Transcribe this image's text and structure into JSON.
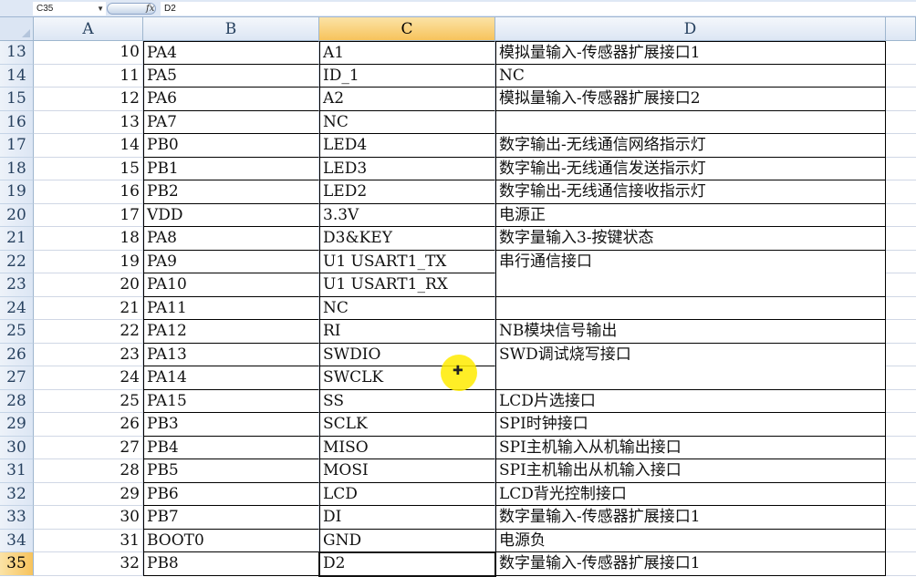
{
  "formula_bar": {
    "name_box": "C35",
    "fx_label": "fx",
    "formula_value": "D2"
  },
  "columns": [
    "A",
    "B",
    "C",
    "D"
  ],
  "active_cell": {
    "row": "35",
    "column": "C"
  },
  "rows": [
    {
      "row": "13",
      "a": "10",
      "b": "PA4",
      "c": "A1",
      "d": "模拟量输入-传感器扩展接口1"
    },
    {
      "row": "14",
      "a": "11",
      "b": "PA5",
      "c": "ID_1",
      "d": "NC"
    },
    {
      "row": "15",
      "a": "12",
      "b": "PA6",
      "c": "A2",
      "d": "模拟量输入-传感器扩展接口2"
    },
    {
      "row": "16",
      "a": "13",
      "b": "PA7",
      "c": "NC",
      "d": ""
    },
    {
      "row": "17",
      "a": "14",
      "b": "PB0",
      "c": "LED4",
      "d": "数字输出-无线通信网络指示灯"
    },
    {
      "row": "18",
      "a": "15",
      "b": "PB1",
      "c": "LED3",
      "d": "数字输出-无线通信发送指示灯"
    },
    {
      "row": "19",
      "a": "16",
      "b": "PB2",
      "c": "LED2",
      "d": "数字输出-无线通信接收指示灯"
    },
    {
      "row": "20",
      "a": "17",
      "b": "VDD",
      "c": "3.3V",
      "d": "电源正"
    },
    {
      "row": "21",
      "a": "18",
      "b": "PA8",
      "c": "D3&KEY",
      "d": "数字量输入3-按键状态"
    },
    {
      "row": "22",
      "a": "19",
      "b": "PA9",
      "c": "U1 USART1_TX",
      "d": "串行通信接口"
    },
    {
      "row": "23",
      "a": "20",
      "b": "PA10",
      "c": "U1 USART1_RX",
      "d": ""
    },
    {
      "row": "24",
      "a": "21",
      "b": "PA11",
      "c": "NC",
      "d": ""
    },
    {
      "row": "25",
      "a": "22",
      "b": "PA12",
      "c": "RI",
      "d": "NB模块信号输出"
    },
    {
      "row": "26",
      "a": "23",
      "b": "PA13",
      "c": "SWDIO",
      "d": "SWD调试烧写接口"
    },
    {
      "row": "27",
      "a": "24",
      "b": "PA14",
      "c": "SWCLK",
      "d": ""
    },
    {
      "row": "28",
      "a": "25",
      "b": "PA15",
      "c": "SS",
      "d": "LCD片选接口"
    },
    {
      "row": "29",
      "a": "26",
      "b": "PB3",
      "c": "SCLK",
      "d": "SPI时钟接口"
    },
    {
      "row": "30",
      "a": "27",
      "b": "PB4",
      "c": "MISO",
      "d": "SPI主机输入从机输出接口"
    },
    {
      "row": "31",
      "a": "28",
      "b": "PB5",
      "c": "MOSI",
      "d": "SPI主机输出从机输入接口"
    },
    {
      "row": "32",
      "a": "29",
      "b": "PB6",
      "c": "LCD",
      "d": "LCD背光控制接口"
    },
    {
      "row": "33",
      "a": "30",
      "b": "PB7",
      "c": "DI",
      "d": "数字量输入-传感器扩展接口1"
    },
    {
      "row": "34",
      "a": "31",
      "b": "BOOT0",
      "c": "GND",
      "d": "电源负"
    },
    {
      "row": "35",
      "a": "32",
      "b": "PB8",
      "c": "D2",
      "d": "数字量输入-传感器扩展接口1"
    }
  ],
  "colors": {
    "header_bg": "#dce6f4",
    "selected_header": "#f7c35c",
    "gridline": "#d0d7e5",
    "cursor_highlight": "#ffeb00"
  }
}
